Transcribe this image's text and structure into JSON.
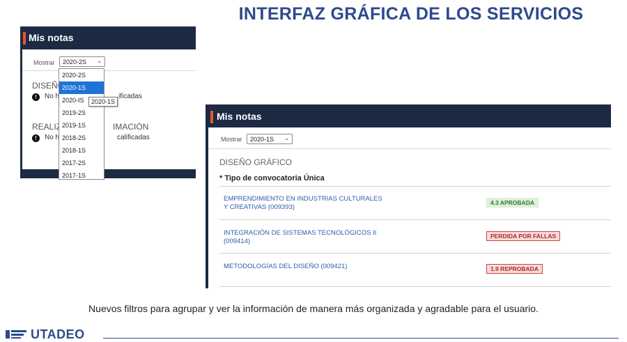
{
  "slide": {
    "title": "INTERFAZ GRÁFICA DE LOS SERVICIOS",
    "caption": "Nuevos filtros para agrupar y ver la información de manera más organizada y agradable para el usuario.",
    "logo_text": "UTADEO"
  },
  "colors": {
    "navy_header": "#1c2a44",
    "accent_orange": "#e8572a",
    "title_blue": "#2e4a8c",
    "link_blue": "#2b5ea8",
    "select_highlight": "#1e74d6",
    "approved_green": "#2f7a2f",
    "failed_red": "#b22a2a"
  },
  "panel_dropdown": {
    "title": "Mis notas",
    "show_label": "Mostrar",
    "selected_value": "2020-2S",
    "section1": "DISEÑO",
    "section1_tail": "",
    "section2": "REALIZA",
    "section2_tail": "IMACIÓN",
    "msg1_start": "No h",
    "msg1_end": "ificadas",
    "msg2_start": "No h",
    "msg2_end": "calificadas",
    "warn_icon": "!",
    "options": [
      "2020-2S",
      "2020-1S",
      "2020-IS",
      "2019-2S",
      "2019-1S",
      "2018-2S",
      "2018-1S",
      "2017-2S",
      "2017-1S"
    ],
    "highlighted_option": "2020-1S",
    "tooltip": "2020-1S"
  },
  "panel_results": {
    "title": "Mis notas",
    "show_label": "Mostrar",
    "selected_value": "2020-1S",
    "section": "DISEÑO GRÁFICO",
    "convocatoria": "* Tipo de convocatoria Única",
    "courses": [
      {
        "name": "EMPRENDIMIENTO EN INDUSTRIAS CULTURALES Y CREATIVAS (009393)",
        "status": "4.3 APROBADA"
      },
      {
        "name": "INTEGRACIÓN DE SISTEMAS TECNOLÓGICOS II (009414)",
        "status": "PERDIDA POR FALLAS"
      },
      {
        "name": "METODOLOGÍAS DEL DISEÑO (009421)",
        "status": "1.9 REPROBADA"
      }
    ]
  }
}
